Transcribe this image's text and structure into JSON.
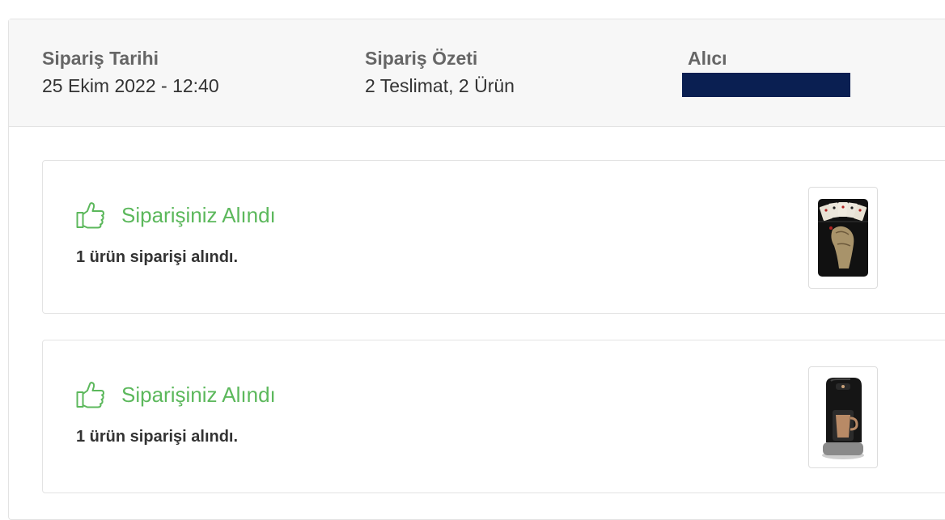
{
  "order": {
    "date_label": "Sipariş Tarihi",
    "date_value": "25 Ekim 2022 - 12:40",
    "summary_label": "Sipariş Özeti",
    "summary_value": "2 Teslimat, 2 Ürün",
    "recipient_label": "Alıcı",
    "recipient_value": ""
  },
  "deliveries": [
    {
      "status": "Siparişiniz Alındı",
      "detail": "1 ürün siparişi alındı.",
      "product_image": "black-playing-cards-lighter-image",
      "icon": "thumbs-up-icon"
    },
    {
      "status": "Siparişiniz Alındı",
      "detail": "1 ürün siparişi alındı.",
      "product_image": "turkish-coffee-machine-image",
      "icon": "thumbs-up-icon"
    }
  ],
  "colors": {
    "status_green": "#5cb85c",
    "recipient_mask": "#0a1f52",
    "header_bg": "#f7f7f7",
    "border": "#e3e3e3"
  }
}
